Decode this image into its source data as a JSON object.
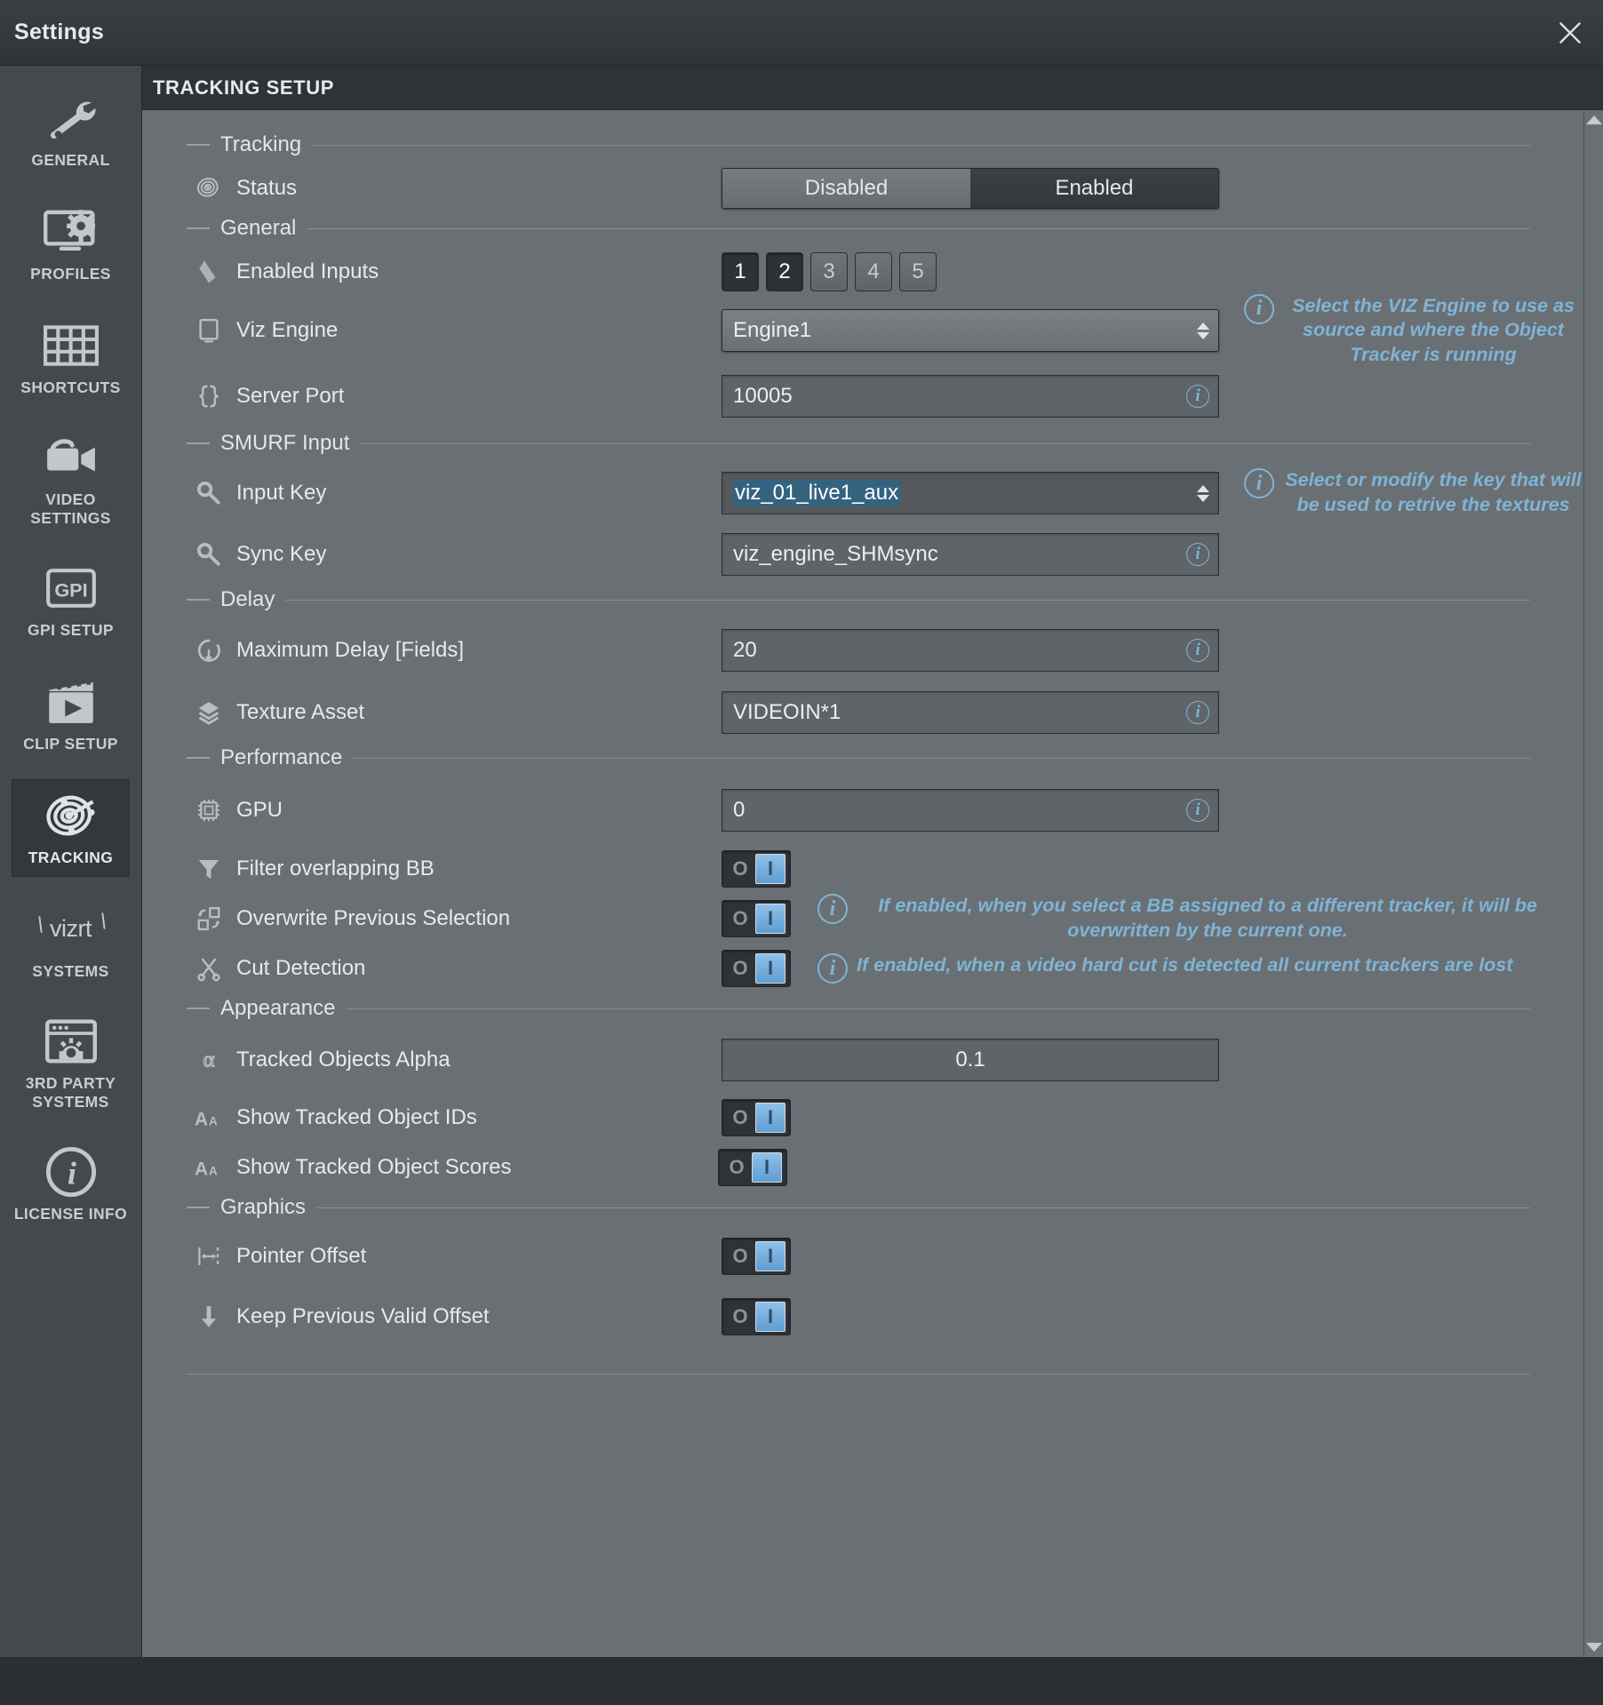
{
  "window": {
    "title": "Settings",
    "close_icon": "close-icon"
  },
  "sidebar": {
    "items": [
      {
        "label": "GENERAL",
        "icon": "wrench-icon",
        "active": false
      },
      {
        "label": "PROFILES",
        "icon": "monitor-gear-icon",
        "active": false
      },
      {
        "label": "SHORTCUTS",
        "icon": "keyboard-icon",
        "active": false
      },
      {
        "label": "VIDEO SETTINGS",
        "icon": "video-camera-icon",
        "active": false
      },
      {
        "label": "GPI SETUP",
        "icon": "gpi-icon",
        "active": false
      },
      {
        "label": "CLIP SETUP",
        "icon": "clapperboard-icon",
        "active": false
      },
      {
        "label": "TRACKING",
        "icon": "radar-target-icon",
        "active": true
      },
      {
        "label": "SYSTEMS",
        "icon": "vizrt-logo-icon",
        "active": false
      },
      {
        "label": "3RD PARTY SYSTEMS",
        "icon": "window-gear-icon",
        "active": false
      },
      {
        "label": "LICENSE INFO",
        "icon": "info-circle-icon",
        "active": false
      }
    ],
    "vizrt_wordmark": "vizrt"
  },
  "page": {
    "title": "TRACKING SETUP"
  },
  "sections": {
    "tracking": {
      "title": "Tracking",
      "status": {
        "label": "Status",
        "icon": "radar-target-icon",
        "options": [
          "Disabled",
          "Enabled"
        ],
        "selected": "Enabled"
      }
    },
    "general": {
      "title": "General",
      "enabled_inputs": {
        "label": "Enabled Inputs",
        "icon": "tag-icon",
        "options": [
          "1",
          "2",
          "3",
          "4",
          "5"
        ],
        "selected": [
          "1",
          "2"
        ]
      },
      "viz_engine": {
        "label": "Viz Engine",
        "icon": "monitor-icon",
        "value": "Engine1",
        "info": "Select the VIZ Engine to use as source and where the Object Tracker is running"
      },
      "server_port": {
        "label": "Server Port",
        "icon": "braces-icon",
        "value": "10005"
      }
    },
    "smurf": {
      "title": "SMURF Input",
      "input_key": {
        "label": "Input Key",
        "icon": "key-icon",
        "value": "viz_01_live1_aux",
        "info": "Select or modify the key that will be used to retrive the textures"
      },
      "sync_key": {
        "label": "Sync Key",
        "icon": "key-icon",
        "value": "viz_engine_SHMsync"
      }
    },
    "delay": {
      "title": "Delay",
      "max_delay": {
        "label": "Maximum Delay [Fields]",
        "icon": "stopwatch-icon",
        "value": "20"
      },
      "texture_asset": {
        "label": "Texture Asset",
        "icon": "layers-icon",
        "value": "VIDEOIN*1"
      }
    },
    "performance": {
      "title": "Performance",
      "gpu": {
        "label": "GPU",
        "icon": "chip-icon",
        "value": "0"
      },
      "filter_overlapping_bb": {
        "label": "Filter overlapping BB",
        "icon": "funnel-icon",
        "state": "on"
      },
      "overwrite_previous_selection": {
        "label": "Overwrite Previous Selection",
        "icon": "swap-boxes-icon",
        "state": "on",
        "info": "If enabled, when you select a BB assigned to a different tracker, it will be overwritten by the current one."
      },
      "cut_detection": {
        "label": "Cut Detection",
        "icon": "scissors-icon",
        "state": "on",
        "info": "If enabled, when a video hard cut is detected all current trackers are lost"
      }
    },
    "appearance": {
      "title": "Appearance",
      "tracked_objects_alpha": {
        "label": "Tracked Objects Alpha",
        "icon": "alpha-icon",
        "value": "0.1"
      },
      "show_tracked_object_ids": {
        "label": "Show Tracked Object IDs",
        "icon": "text-size-icon",
        "state": "on"
      },
      "show_tracked_object_scores": {
        "label": "Show Tracked Object Scores",
        "icon": "text-size-icon",
        "state": "on"
      }
    },
    "graphics": {
      "title": "Graphics",
      "pointer_offset": {
        "label": "Pointer Offset",
        "icon": "horizontal-offset-icon",
        "state": "on"
      },
      "keep_previous_valid_offset": {
        "label": "Keep Previous Valid Offset",
        "icon": "arrow-down-icon",
        "state": "on"
      }
    }
  },
  "toggle_glyphs": {
    "off": "O",
    "on": "I"
  },
  "colors": {
    "accent_info": "#7fb4d6",
    "panel_bg": "#6a6f73",
    "sidebar_bg": "#44494e",
    "selection": "#35637f"
  }
}
